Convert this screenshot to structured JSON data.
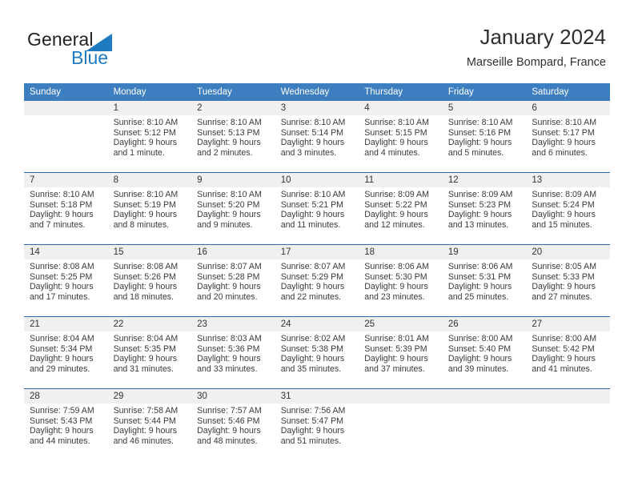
{
  "brand": {
    "word_one": "General",
    "word_two": "Blue",
    "triangle_icon": "triangle-icon",
    "accent_color": "#1f7bc1"
  },
  "header": {
    "title": "January 2024",
    "subtitle": "Marseille Bompard, France"
  },
  "calendar": {
    "header_bg": "#3c7ebf",
    "band_bg": "#f0f0f0",
    "rule_color": "#2c6ca8",
    "weekday_headers": [
      "Sunday",
      "Monday",
      "Tuesday",
      "Wednesday",
      "Thursday",
      "Friday",
      "Saturday"
    ],
    "weeks": [
      [
        {
          "day": "",
          "sunrise": "",
          "sunset": "",
          "daylight_line1": "",
          "daylight_line2": ""
        },
        {
          "day": "1",
          "sunrise": "Sunrise: 8:10 AM",
          "sunset": "Sunset: 5:12 PM",
          "daylight_line1": "Daylight: 9 hours",
          "daylight_line2": "and 1 minute."
        },
        {
          "day": "2",
          "sunrise": "Sunrise: 8:10 AM",
          "sunset": "Sunset: 5:13 PM",
          "daylight_line1": "Daylight: 9 hours",
          "daylight_line2": "and 2 minutes."
        },
        {
          "day": "3",
          "sunrise": "Sunrise: 8:10 AM",
          "sunset": "Sunset: 5:14 PM",
          "daylight_line1": "Daylight: 9 hours",
          "daylight_line2": "and 3 minutes."
        },
        {
          "day": "4",
          "sunrise": "Sunrise: 8:10 AM",
          "sunset": "Sunset: 5:15 PM",
          "daylight_line1": "Daylight: 9 hours",
          "daylight_line2": "and 4 minutes."
        },
        {
          "day": "5",
          "sunrise": "Sunrise: 8:10 AM",
          "sunset": "Sunset: 5:16 PM",
          "daylight_line1": "Daylight: 9 hours",
          "daylight_line2": "and 5 minutes."
        },
        {
          "day": "6",
          "sunrise": "Sunrise: 8:10 AM",
          "sunset": "Sunset: 5:17 PM",
          "daylight_line1": "Daylight: 9 hours",
          "daylight_line2": "and 6 minutes."
        }
      ],
      [
        {
          "day": "7",
          "sunrise": "Sunrise: 8:10 AM",
          "sunset": "Sunset: 5:18 PM",
          "daylight_line1": "Daylight: 9 hours",
          "daylight_line2": "and 7 minutes."
        },
        {
          "day": "8",
          "sunrise": "Sunrise: 8:10 AM",
          "sunset": "Sunset: 5:19 PM",
          "daylight_line1": "Daylight: 9 hours",
          "daylight_line2": "and 8 minutes."
        },
        {
          "day": "9",
          "sunrise": "Sunrise: 8:10 AM",
          "sunset": "Sunset: 5:20 PM",
          "daylight_line1": "Daylight: 9 hours",
          "daylight_line2": "and 9 minutes."
        },
        {
          "day": "10",
          "sunrise": "Sunrise: 8:10 AM",
          "sunset": "Sunset: 5:21 PM",
          "daylight_line1": "Daylight: 9 hours",
          "daylight_line2": "and 11 minutes."
        },
        {
          "day": "11",
          "sunrise": "Sunrise: 8:09 AM",
          "sunset": "Sunset: 5:22 PM",
          "daylight_line1": "Daylight: 9 hours",
          "daylight_line2": "and 12 minutes."
        },
        {
          "day": "12",
          "sunrise": "Sunrise: 8:09 AM",
          "sunset": "Sunset: 5:23 PM",
          "daylight_line1": "Daylight: 9 hours",
          "daylight_line2": "and 13 minutes."
        },
        {
          "day": "13",
          "sunrise": "Sunrise: 8:09 AM",
          "sunset": "Sunset: 5:24 PM",
          "daylight_line1": "Daylight: 9 hours",
          "daylight_line2": "and 15 minutes."
        }
      ],
      [
        {
          "day": "14",
          "sunrise": "Sunrise: 8:08 AM",
          "sunset": "Sunset: 5:25 PM",
          "daylight_line1": "Daylight: 9 hours",
          "daylight_line2": "and 17 minutes."
        },
        {
          "day": "15",
          "sunrise": "Sunrise: 8:08 AM",
          "sunset": "Sunset: 5:26 PM",
          "daylight_line1": "Daylight: 9 hours",
          "daylight_line2": "and 18 minutes."
        },
        {
          "day": "16",
          "sunrise": "Sunrise: 8:07 AM",
          "sunset": "Sunset: 5:28 PM",
          "daylight_line1": "Daylight: 9 hours",
          "daylight_line2": "and 20 minutes."
        },
        {
          "day": "17",
          "sunrise": "Sunrise: 8:07 AM",
          "sunset": "Sunset: 5:29 PM",
          "daylight_line1": "Daylight: 9 hours",
          "daylight_line2": "and 22 minutes."
        },
        {
          "day": "18",
          "sunrise": "Sunrise: 8:06 AM",
          "sunset": "Sunset: 5:30 PM",
          "daylight_line1": "Daylight: 9 hours",
          "daylight_line2": "and 23 minutes."
        },
        {
          "day": "19",
          "sunrise": "Sunrise: 8:06 AM",
          "sunset": "Sunset: 5:31 PM",
          "daylight_line1": "Daylight: 9 hours",
          "daylight_line2": "and 25 minutes."
        },
        {
          "day": "20",
          "sunrise": "Sunrise: 8:05 AM",
          "sunset": "Sunset: 5:33 PM",
          "daylight_line1": "Daylight: 9 hours",
          "daylight_line2": "and 27 minutes."
        }
      ],
      [
        {
          "day": "21",
          "sunrise": "Sunrise: 8:04 AM",
          "sunset": "Sunset: 5:34 PM",
          "daylight_line1": "Daylight: 9 hours",
          "daylight_line2": "and 29 minutes."
        },
        {
          "day": "22",
          "sunrise": "Sunrise: 8:04 AM",
          "sunset": "Sunset: 5:35 PM",
          "daylight_line1": "Daylight: 9 hours",
          "daylight_line2": "and 31 minutes."
        },
        {
          "day": "23",
          "sunrise": "Sunrise: 8:03 AM",
          "sunset": "Sunset: 5:36 PM",
          "daylight_line1": "Daylight: 9 hours",
          "daylight_line2": "and 33 minutes."
        },
        {
          "day": "24",
          "sunrise": "Sunrise: 8:02 AM",
          "sunset": "Sunset: 5:38 PM",
          "daylight_line1": "Daylight: 9 hours",
          "daylight_line2": "and 35 minutes."
        },
        {
          "day": "25",
          "sunrise": "Sunrise: 8:01 AM",
          "sunset": "Sunset: 5:39 PM",
          "daylight_line1": "Daylight: 9 hours",
          "daylight_line2": "and 37 minutes."
        },
        {
          "day": "26",
          "sunrise": "Sunrise: 8:00 AM",
          "sunset": "Sunset: 5:40 PM",
          "daylight_line1": "Daylight: 9 hours",
          "daylight_line2": "and 39 minutes."
        },
        {
          "day": "27",
          "sunrise": "Sunrise: 8:00 AM",
          "sunset": "Sunset: 5:42 PM",
          "daylight_line1": "Daylight: 9 hours",
          "daylight_line2": "and 41 minutes."
        }
      ],
      [
        {
          "day": "28",
          "sunrise": "Sunrise: 7:59 AM",
          "sunset": "Sunset: 5:43 PM",
          "daylight_line1": "Daylight: 9 hours",
          "daylight_line2": "and 44 minutes."
        },
        {
          "day": "29",
          "sunrise": "Sunrise: 7:58 AM",
          "sunset": "Sunset: 5:44 PM",
          "daylight_line1": "Daylight: 9 hours",
          "daylight_line2": "and 46 minutes."
        },
        {
          "day": "30",
          "sunrise": "Sunrise: 7:57 AM",
          "sunset": "Sunset: 5:46 PM",
          "daylight_line1": "Daylight: 9 hours",
          "daylight_line2": "and 48 minutes."
        },
        {
          "day": "31",
          "sunrise": "Sunrise: 7:56 AM",
          "sunset": "Sunset: 5:47 PM",
          "daylight_line1": "Daylight: 9 hours",
          "daylight_line2": "and 51 minutes."
        },
        {
          "day": "",
          "sunrise": "",
          "sunset": "",
          "daylight_line1": "",
          "daylight_line2": ""
        },
        {
          "day": "",
          "sunrise": "",
          "sunset": "",
          "daylight_line1": "",
          "daylight_line2": ""
        },
        {
          "day": "",
          "sunrise": "",
          "sunset": "",
          "daylight_line1": "",
          "daylight_line2": ""
        }
      ]
    ]
  }
}
